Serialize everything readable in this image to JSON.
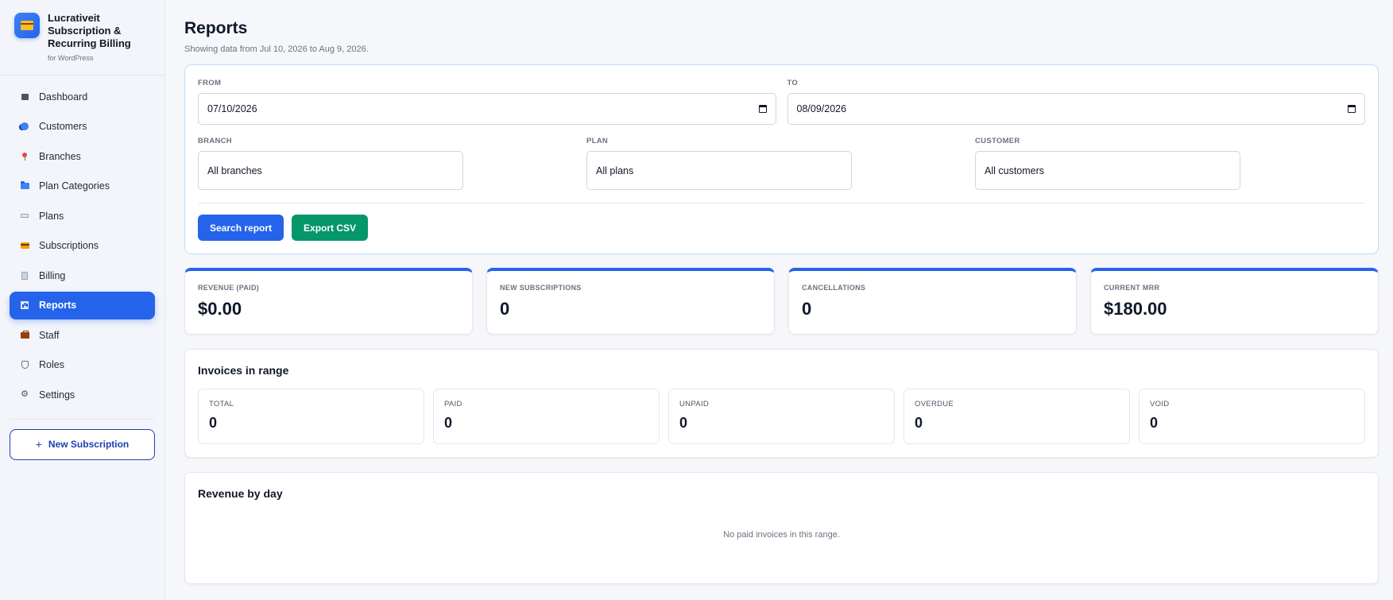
{
  "brand": {
    "name": "Lucrativeit Subscription & Recurring Billing",
    "sub": "for WordPress",
    "logo_icon": "credit-card-icon"
  },
  "nav": {
    "items": [
      {
        "label": "Dashboard",
        "icon": "dashboard-icon"
      },
      {
        "label": "Customers",
        "icon": "customers-icon"
      },
      {
        "label": "Branches",
        "icon": "pin-icon"
      },
      {
        "label": "Plan Categories",
        "icon": "folder-icon"
      },
      {
        "label": "Plans",
        "icon": "tag-icon"
      },
      {
        "label": "Subscriptions",
        "icon": "card-icon"
      },
      {
        "label": "Billing",
        "icon": "receipt-icon"
      },
      {
        "label": "Reports",
        "icon": "chart-icon",
        "active": true
      },
      {
        "label": "Staff",
        "icon": "briefcase-icon"
      },
      {
        "label": "Roles",
        "icon": "shield-icon"
      },
      {
        "label": "Settings",
        "icon": "gear-icon"
      }
    ],
    "new_subscription_label": "New Subscription",
    "new_subscription_glyph": "+"
  },
  "page": {
    "title": "Reports",
    "subtitle": "Showing data from Jul 10, 2026 to Aug 9, 2026."
  },
  "filters": {
    "from_label": "FROM",
    "from_value": "07/10/2026",
    "to_label": "TO",
    "to_value": "08/09/2026",
    "branch_label": "BRANCH",
    "branch_value": "All branches",
    "plan_label": "PLAN",
    "plan_value": "All plans",
    "customer_label": "CUSTOMER",
    "customer_value": "All customers",
    "search_label": "Search report",
    "export_label": "Export CSV"
  },
  "kpis": [
    {
      "label": "REVENUE (PAID)",
      "value": "$0.00"
    },
    {
      "label": "NEW SUBSCRIPTIONS",
      "value": "0"
    },
    {
      "label": "CANCELLATIONS",
      "value": "0"
    },
    {
      "label": "CURRENT MRR",
      "value": "$180.00"
    }
  ],
  "invoices": {
    "title": "Invoices in range",
    "items": [
      {
        "label": "TOTAL",
        "value": "0"
      },
      {
        "label": "PAID",
        "value": "0"
      },
      {
        "label": "UNPAID",
        "value": "0"
      },
      {
        "label": "OVERDUE",
        "value": "0"
      },
      {
        "label": "VOID",
        "value": "0"
      }
    ]
  },
  "revenue": {
    "title": "Revenue by day",
    "empty_text": "No paid invoices in this range."
  },
  "colors": {
    "accent": "#2563eb",
    "success": "#059669"
  }
}
